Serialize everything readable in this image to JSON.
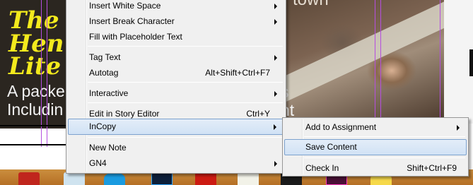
{
  "document": {
    "left_lines_yellow": [
      "The",
      "Hen",
      "Lite"
    ],
    "left_lines_white": [
      "A packe",
      "Includin"
    ],
    "right_words": [
      "s",
      "nt"
    ],
    "photo_clipped_word": "town"
  },
  "context_menu": {
    "items": [
      {
        "label": "Insert White Space",
        "shortcut": "",
        "submenu": true
      },
      {
        "label": "Insert Break Character",
        "shortcut": "",
        "submenu": true
      },
      {
        "label": "Fill with Placeholder Text",
        "shortcut": "",
        "submenu": false
      },
      {
        "label": "Tag Text",
        "shortcut": "",
        "submenu": true
      },
      {
        "label": "Autotag",
        "shortcut": "Alt+Shift+Ctrl+F7",
        "submenu": false
      },
      {
        "label": "Interactive",
        "shortcut": "",
        "submenu": true
      },
      {
        "label": "Edit in Story Editor",
        "shortcut": "Ctrl+Y",
        "submenu": false
      },
      {
        "label": "InCopy",
        "shortcut": "",
        "submenu": true
      },
      {
        "label": "New Note",
        "shortcut": "",
        "submenu": false
      },
      {
        "label": "GN4",
        "shortcut": "",
        "submenu": true
      }
    ]
  },
  "incopy_submenu": {
    "items": [
      {
        "label": "Add to Assignment",
        "shortcut": "",
        "submenu": true
      },
      {
        "label": "Save Content",
        "shortcut": "",
        "submenu": false
      },
      {
        "label": "Check In",
        "shortcut": "Shift+Ctrl+F9",
        "submenu": false
      }
    ]
  },
  "colors": {
    "menu_background": "#f0f0f0",
    "highlight_border": "#7da2ce",
    "guide_line": "#b54ee0",
    "taskbar": "#c17f33",
    "headline_yellow": "#f3ea1d"
  },
  "taskbar": {
    "icons": [
      "acrobat-icon",
      "explorer-icon",
      "skype-icon",
      "photoshop-icon",
      "acrobat-reader-icon",
      "notepad-icon",
      "terminal-icon",
      "indesign-icon",
      "help-icon"
    ]
  }
}
